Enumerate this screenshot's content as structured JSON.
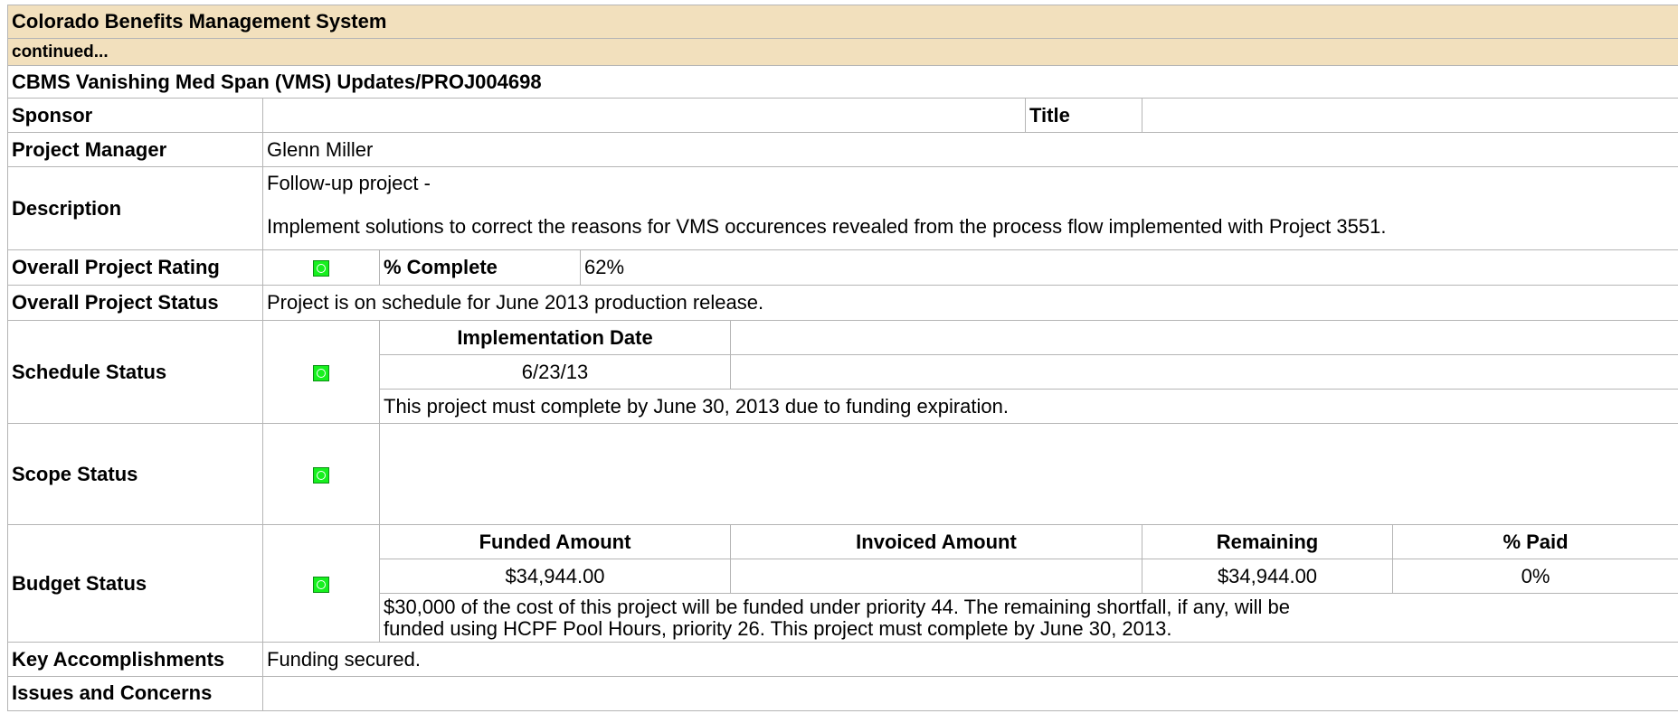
{
  "system_title": "Colorado Benefits Management System",
  "continued": "continued...",
  "project_title": "CBMS Vanishing Med Span (VMS) Updates/PROJ004698",
  "labels": {
    "sponsor": "Sponsor",
    "title": "Title",
    "project_manager": "Project Manager",
    "description": "Description",
    "overall_rating": "Overall Project Rating",
    "percent_complete": "% Complete",
    "overall_status": "Overall Project Status",
    "schedule_status": "Schedule Status",
    "scope_status": "Scope Status",
    "budget_status": "Budget Status",
    "key_accomplishments": "Key Accomplishments",
    "issues": "Issues and Concerns"
  },
  "values": {
    "sponsor": "",
    "title": "",
    "project_manager": "Glenn Miller",
    "description_line1": "Follow-up project -",
    "description_line2": "Implement solutions to correct the reasons for VMS occurences revealed  from the process flow implemented with Project 3551.",
    "percent_complete": "62%",
    "overall_status": "Project is on schedule for June 2013 production release.",
    "key_accomplishments": "Funding secured.",
    "issues": ""
  },
  "schedule": {
    "impl_date_label": "Implementation Date",
    "impl_date": "6/23/13",
    "note": "This project must complete by June 30, 2013 due to funding expiration."
  },
  "budget": {
    "headers": [
      "Funded Amount",
      "Invoiced Amount",
      "Remaining",
      "% Paid"
    ],
    "values": [
      "$34,944.00",
      "",
      "$34,944.00",
      "0%"
    ],
    "note_line1": "$30,000 of the cost of this project will be funded under priority 44.  The remaining shortfall, if any, will be",
    "note_line2": "funded using HCPF Pool Hours, priority 26.  This project must complete by June 30, 2013."
  },
  "status_indicators": {
    "overall": "green",
    "schedule": "green",
    "scope": "green",
    "budget": "green",
    "color": "#17f01f"
  }
}
